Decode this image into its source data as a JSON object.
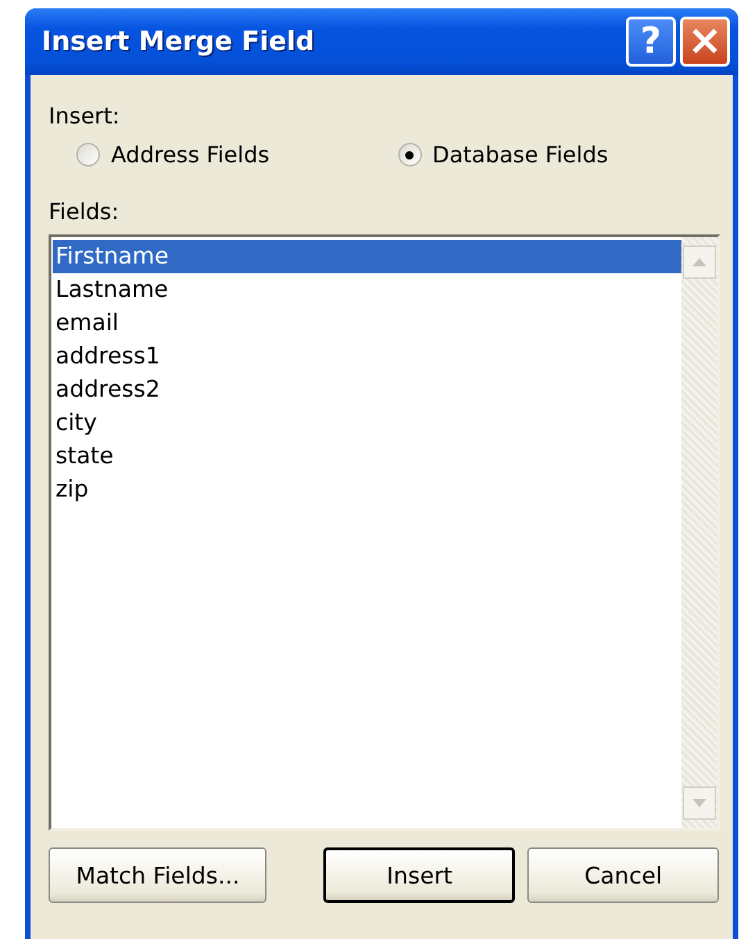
{
  "window": {
    "title": "Insert Merge Field",
    "title_buttons": [
      {
        "kind": "help",
        "label": "?"
      },
      {
        "kind": "close",
        "label": "×"
      }
    ]
  },
  "insert": {
    "label": "Insert:",
    "options": [
      {
        "label": "Address Fields",
        "selected": false
      },
      {
        "label": "Database Fields",
        "selected": true
      }
    ]
  },
  "fields": {
    "label": "Fields:",
    "items": [
      {
        "label": "Firstname",
        "selected": true
      },
      {
        "label": "Lastname",
        "selected": false
      },
      {
        "label": "email",
        "selected": false
      },
      {
        "label": "address1",
        "selected": false
      },
      {
        "label": "address2",
        "selected": false
      },
      {
        "label": "city",
        "selected": false
      },
      {
        "label": "state",
        "selected": false
      },
      {
        "label": "zip",
        "selected": false
      }
    ]
  },
  "buttons": [
    {
      "label": "Match Fields...",
      "default": false
    },
    {
      "label": "Insert",
      "default": true
    },
    {
      "label": "Cancel",
      "default": false
    }
  ]
}
